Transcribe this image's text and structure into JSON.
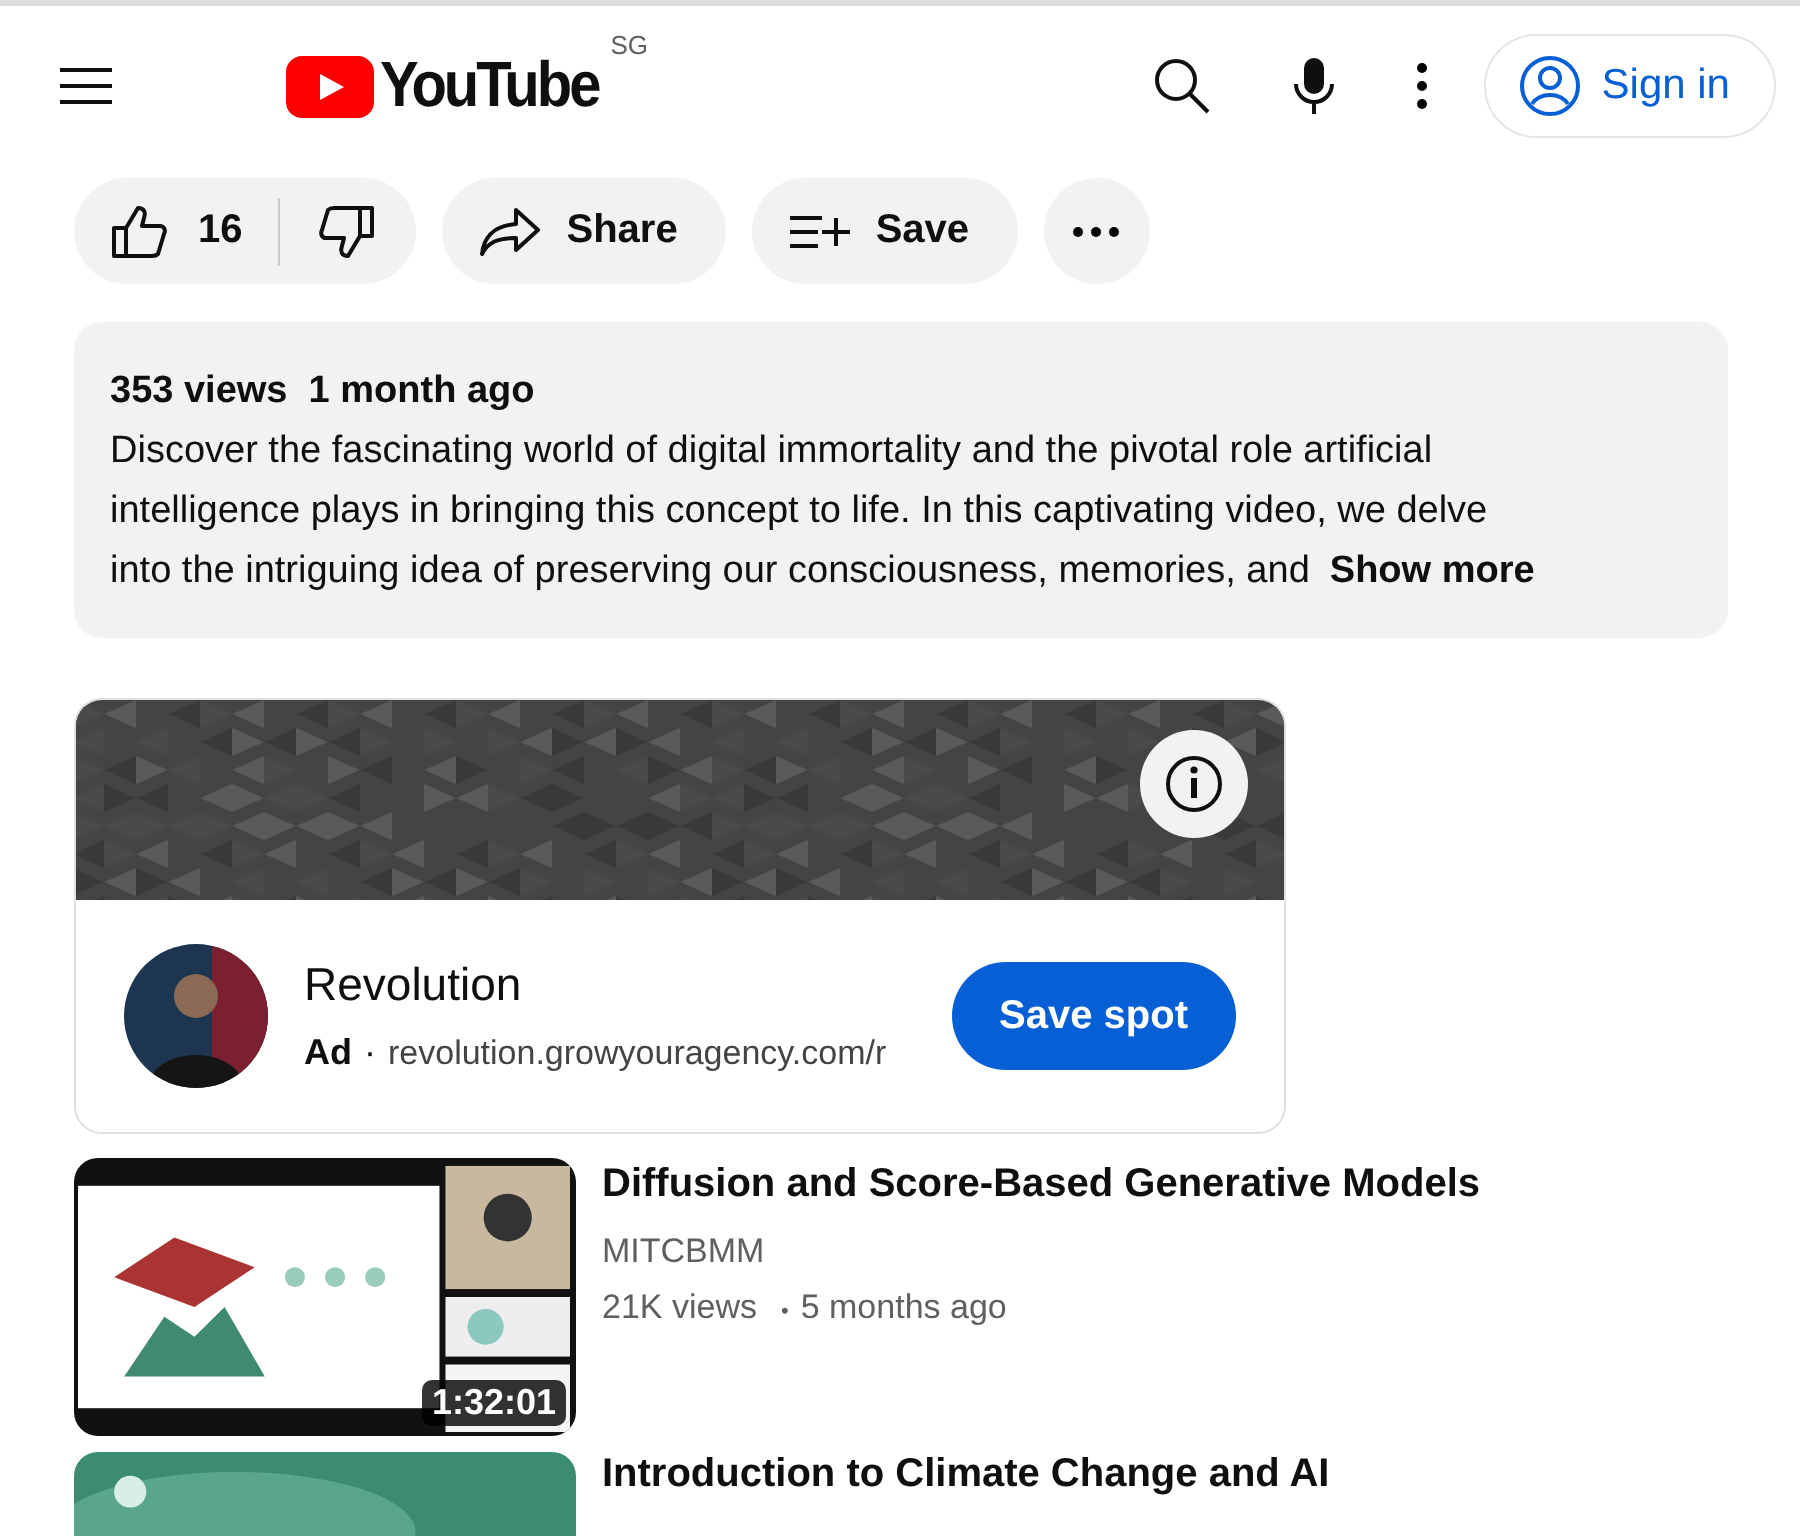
{
  "header": {
    "logo": "YouTube",
    "region": "SG",
    "sign_in": "Sign in"
  },
  "actions": {
    "likes": "16",
    "share": "Share",
    "save": "Save"
  },
  "description": {
    "stats": "353 views  1 month ago",
    "lines": [
      "Discover the fascinating world of digital immortality and the pivotal role artificial",
      "intelligence plays in bringing this concept to life. In this captivating video, we delve",
      "into the intriguing idea of preserving our consciousness, memories, and"
    ],
    "show_more": "Show more"
  },
  "ad": {
    "name": "Revolution",
    "label": "Ad",
    "separator": "·",
    "url": "revolution.growyouragency.com/r",
    "button": "Save spot"
  },
  "videos": [
    {
      "title": "Diffusion and Score-Based Generative Models",
      "channel": "MITCBMM",
      "views": "21K views",
      "separator": "•",
      "age": "5 months ago",
      "duration": "1:32:01",
      "kind": "slides"
    },
    {
      "title": "Introduction to Climate Change and AI",
      "kind": "earth"
    }
  ]
}
